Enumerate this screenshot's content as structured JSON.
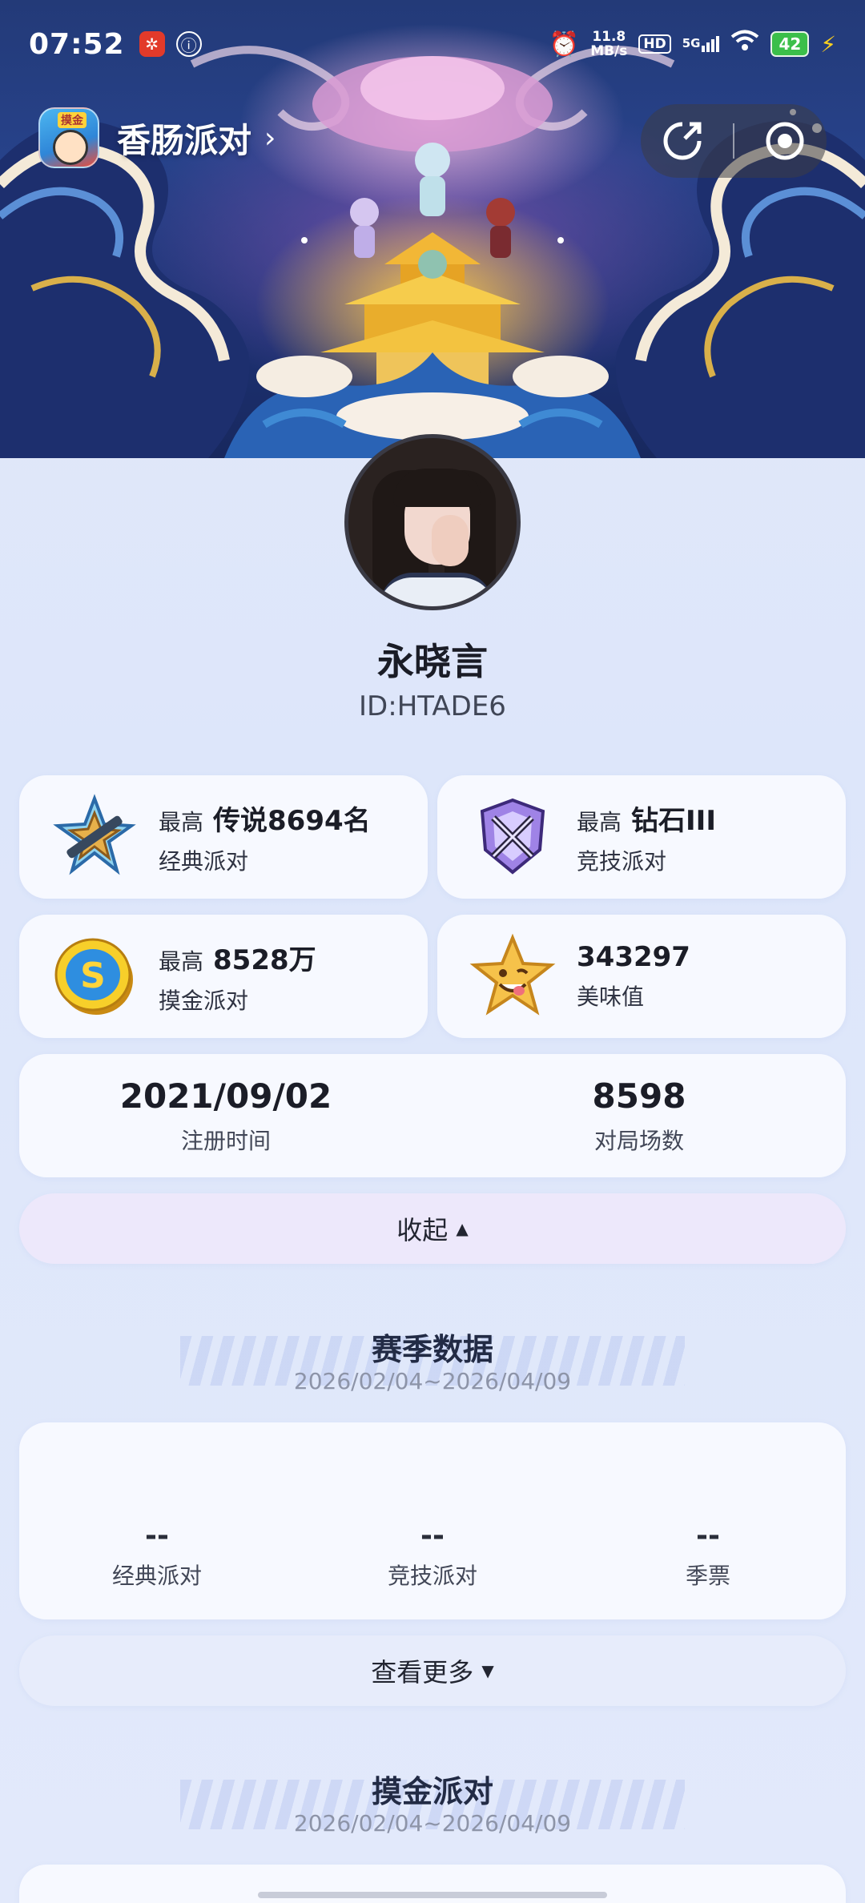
{
  "status_bar": {
    "time": "07:52",
    "net_speed_value": "11.8",
    "net_speed_unit": "MB/s",
    "hd": "HD",
    "signal": "5G",
    "battery": "42"
  },
  "app": {
    "name": "香肠派对",
    "icon_tag": "摸金"
  },
  "profile": {
    "name": "永晓言",
    "id": "ID:HTADE6"
  },
  "stats": [
    {
      "prefix": "最高",
      "value": "传说8694名",
      "label": "经典派对",
      "icon": "star-rank-badge-icon"
    },
    {
      "prefix": "最高",
      "value": "钻石III",
      "label": "竞技派对",
      "icon": "diamond-shield-icon"
    },
    {
      "prefix": "最高",
      "value": "8528万",
      "label": "摸金派对",
      "icon": "gold-coin-icon"
    },
    {
      "prefix": "",
      "value": "343297",
      "label": "美味值",
      "icon": "smiley-star-icon"
    }
  ],
  "summary": {
    "register_date": "2021/09/02",
    "register_label": "注册时间",
    "matches": "8598",
    "matches_label": "对局场数"
  },
  "collapse_button": {
    "label": "收起",
    "arrow": "▲"
  },
  "season_section": {
    "title": "赛季数据",
    "range": "2026/02/04~2026/04/09",
    "columns": [
      {
        "value": "--",
        "label": "经典派对"
      },
      {
        "value": "--",
        "label": "竞技派对"
      },
      {
        "value": "--",
        "label": "季票"
      }
    ]
  },
  "more_button": {
    "label": "查看更多",
    "arrow": "▼"
  },
  "gold_section": {
    "title": "摸金派对",
    "range": "2026/02/04~2026/04/09"
  },
  "colors": {
    "page_bg": "#dde6fa",
    "card_bg": "#f7f9ff",
    "toggle_bg": "#ede8fb",
    "section_title": "#222b45"
  }
}
